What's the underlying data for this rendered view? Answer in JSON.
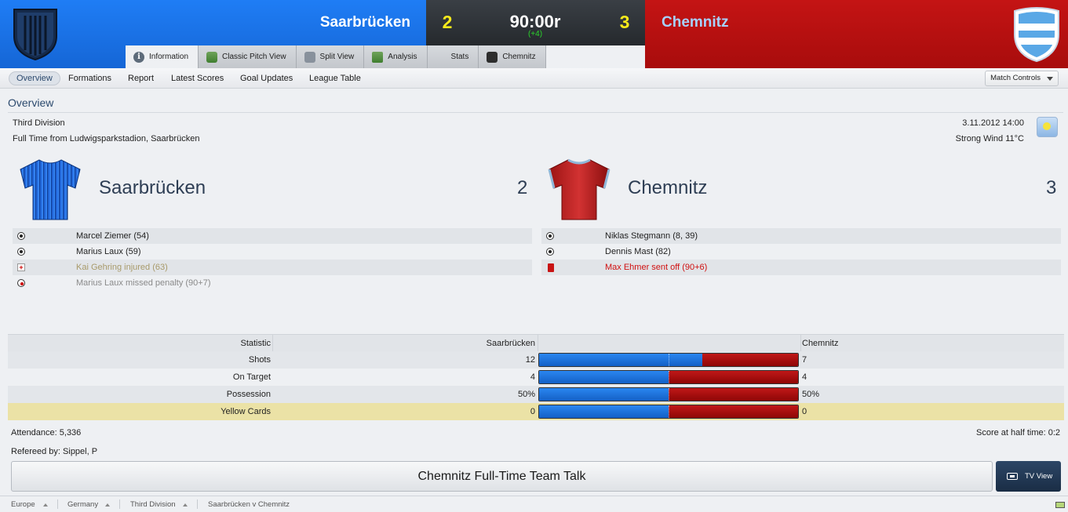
{
  "header": {
    "home_team": "Saarbrücken",
    "away_team": "Chemnitz",
    "home_score": "2",
    "away_score": "3",
    "clock": "90:00r",
    "added_time": "(+4)",
    "home_color": "#1f7df5",
    "away_color": "#c41414"
  },
  "tabs": [
    {
      "label": "Information",
      "icon": "info-icon"
    },
    {
      "label": "Classic Pitch View",
      "icon": "pitch-icon"
    },
    {
      "label": "Split View",
      "icon": "split-view-icon"
    },
    {
      "label": "Analysis",
      "icon": "analysis-icon"
    },
    {
      "label": "Stats",
      "icon": "stats-icon"
    },
    {
      "label": "Chemnitz",
      "icon": "club-icon"
    }
  ],
  "subnav": {
    "items": [
      "Overview",
      "Formations",
      "Report",
      "Latest Scores",
      "Goal Updates",
      "League Table"
    ],
    "match_controls": "Match Controls"
  },
  "overview": {
    "title": "Overview",
    "competition": "Third Division",
    "venue": "Full Time from Ludwigsparkstadion, Saarbrücken",
    "date": "3.11.2012 14:00",
    "weather": "Strong Wind 11°C",
    "home_team": "Saarbrücken",
    "home_score": "2",
    "away_team": "Chemnitz",
    "away_score": "3"
  },
  "home_events": [
    {
      "icon": "goal-icon",
      "text": "Marcel Ziemer (54)",
      "color": "#222222"
    },
    {
      "icon": "goal-icon",
      "text": "Marius Laux (59)",
      "color": "#222222"
    },
    {
      "icon": "injury-icon",
      "text": "Kai Gehring injured (63)",
      "color": "#a89a6a"
    },
    {
      "icon": "missed-penalty-icon",
      "text": "Marius Laux missed penalty (90+7)",
      "color": "#8a8a8a"
    }
  ],
  "away_events": [
    {
      "icon": "goal-icon",
      "text": "Niklas Stegmann (8, 39)",
      "color": "#222222"
    },
    {
      "icon": "goal-icon",
      "text": "Dennis Mast (82)",
      "color": "#222222"
    },
    {
      "icon": "red-card-icon",
      "text": "Max Ehmer sent off (90+6)",
      "color": "#d01010"
    }
  ],
  "stats": {
    "headers": {
      "statistic": "Statistic",
      "home": "Saarbrücken",
      "away": "Chemnitz"
    },
    "rows": [
      {
        "label": "Shots",
        "home": "12",
        "away": "7",
        "home_share": 0.63
      },
      {
        "label": "On Target",
        "home": "4",
        "away": "4",
        "home_share": 0.5
      },
      {
        "label": "Possession",
        "home": "50%",
        "away": "50%",
        "home_share": 0.5
      },
      {
        "label": "Yellow Cards",
        "home": "0",
        "away": "0",
        "home_share": 0.5
      }
    ]
  },
  "footer": {
    "attendance": "Attendance: 5,336",
    "referee": "Refereed by: Sippel, P",
    "halftime": "Score at half time: 0:2",
    "team_talk": "Chemnitz Full-Time Team Talk",
    "tv_view": "TV View"
  },
  "breadcrumb": [
    "Europe",
    "Germany",
    "Third Division",
    "Saarbrücken v Chemnitz"
  ]
}
